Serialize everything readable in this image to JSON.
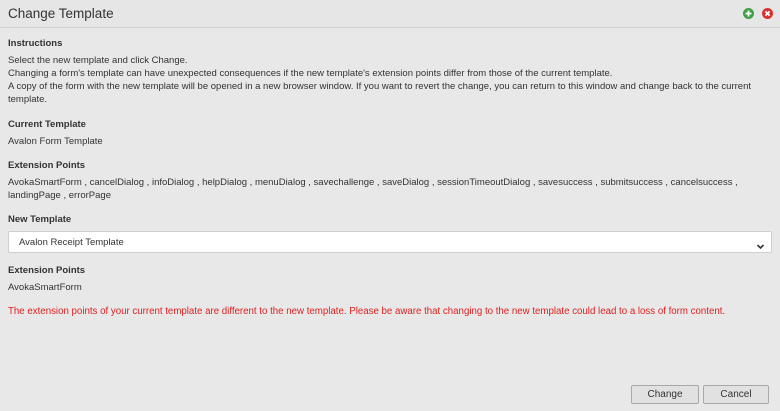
{
  "dialog": {
    "title": "Change Template",
    "add_icon_color": "#3fa048",
    "close_icon_color": "#d9312f"
  },
  "instructions": {
    "heading": "Instructions",
    "line1": "Select the new template and click Change.",
    "line2": "Changing a form's template can have unexpected consequences if the new template's extension points differ from those of the current template.",
    "line3a": "A copy of the form with the new template will be opened in a new browser window. If you want to revert the change, you can return to this window and change back to the current",
    "line3b": "template."
  },
  "current_template": {
    "heading": "Current Template",
    "value": "Avalon Form Template"
  },
  "current_extension_points": {
    "heading": "Extension Points",
    "line1": "AvokaSmartForm , cancelDialog , infoDialog , helpDialog , menuDialog , savechallenge , saveDialog , sessionTimeoutDialog , savesuccess , submitsuccess , cancelsuccess ,",
    "line2": "landingPage , errorPage"
  },
  "new_template": {
    "heading": "New Template",
    "selected": "Avalon Receipt Template"
  },
  "new_extension_points": {
    "heading": "Extension Points",
    "value": "AvokaSmartForm"
  },
  "warning": {
    "text": "The extension points of your current template are different to the new template. Please be aware that changing to the new template could lead to a loss of form content.",
    "color": "#e02020"
  },
  "buttons": {
    "change": "Change",
    "cancel": "Cancel"
  }
}
